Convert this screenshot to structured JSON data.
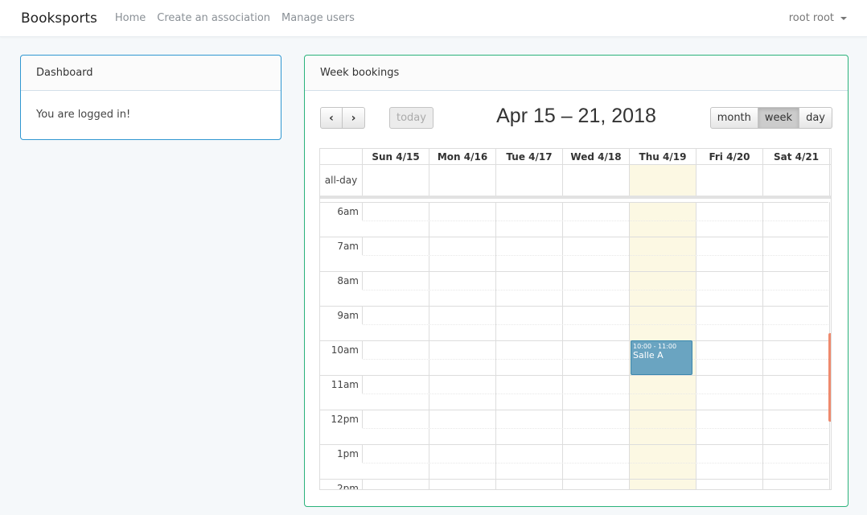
{
  "navbar": {
    "brand": "Booksports",
    "links": [
      "Home",
      "Create an association",
      "Manage users"
    ],
    "user": "root root"
  },
  "dashboard": {
    "title": "Dashboard",
    "message": "You are logged in!"
  },
  "week": {
    "title": "Week bookings",
    "range_title": "Apr 15 – 21, 2018",
    "prev_icon": "chevron-left-icon",
    "next_icon": "chevron-right-icon",
    "prev_glyph": "‹",
    "next_glyph": "›",
    "today_label": "today",
    "views": [
      "month",
      "week",
      "day"
    ],
    "active_view": "week",
    "days": [
      "Sun 4/15",
      "Mon 4/16",
      "Tue 4/17",
      "Wed 4/18",
      "Thu 4/19",
      "Fri 4/20",
      "Sat 4/21"
    ],
    "today_index": 4,
    "allday_label": "all-day",
    "hours": [
      "6am",
      "7am",
      "8am",
      "9am",
      "10am",
      "11am",
      "12pm",
      "1pm",
      "2pm"
    ],
    "events": [
      {
        "time": "10:00 - 11:00",
        "title": "Salle A",
        "day_index": 4
      }
    ]
  },
  "colors": {
    "dashboard_border": "#3097d1",
    "week_border": "#2ab27b",
    "today_bg": "#fcf8e3",
    "event_bg": "#6aa4c1",
    "scrollbar": "#ee8a6e"
  }
}
